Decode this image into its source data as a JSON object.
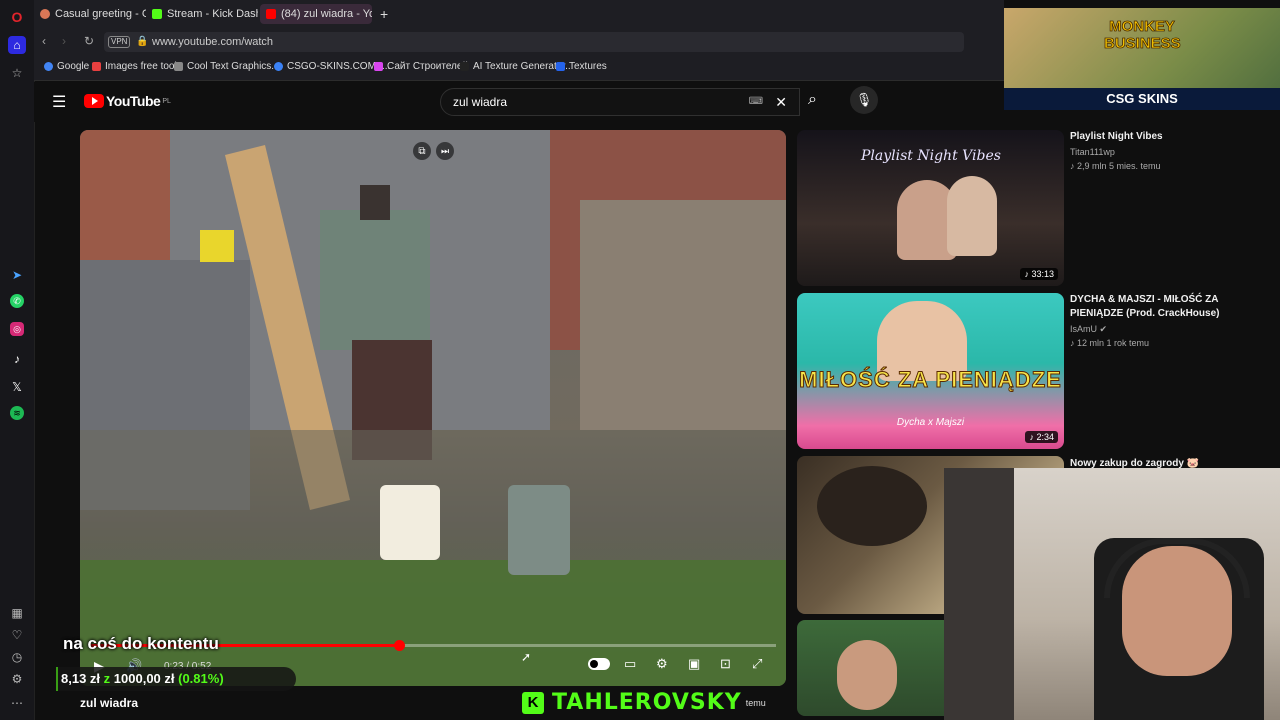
{
  "browser": {
    "tabs": [
      {
        "label": "Casual greeting - Claude"
      },
      {
        "label": "Stream - Kick Dashboard"
      },
      {
        "label": "(84) zul wiadra - YouTube"
      }
    ],
    "new_tab": "+",
    "vpn_badge": "VPN",
    "url": "www.youtube.com/watch",
    "bookmarks": [
      {
        "label": "Google"
      },
      {
        "label": "Images free tools"
      },
      {
        "label": "Cool Text Graphics..."
      },
      {
        "label": "CSGO-SKINS.COM -..."
      },
      {
        "label": "Сайт Строителей"
      },
      {
        "label": "AI Texture Generator..."
      },
      {
        "label": "Textures"
      }
    ]
  },
  "youtube": {
    "logo_text": "YouTube",
    "region": "PL",
    "search_value": "zul wiadra",
    "video_title": "zul wiadra",
    "player": {
      "time": "0:23 / 0:52",
      "progress": 0.45
    },
    "recommendations": [
      {
        "title": "Playlist Night Vibes",
        "thumb_text": "Playlist Night Vibes",
        "channel": "Titan111wp",
        "meta": "2,9 mln  5 mies. temu",
        "duration": "33:13"
      },
      {
        "title": "DYCHA & MAJSZI - MIŁOŚĆ ZA PIENIĄDZE (Prod. CrackHouse)",
        "thumb_text": "MIŁOŚĆ ZA PIENIĄDZE",
        "thumb_sub": "Dycha x Majszi",
        "channel": "IsAmU",
        "meta": "12 mln  1 rok temu",
        "duration": "2:34"
      },
      {
        "title": "Nowy zakup do zagrody 🐷"
      }
    ]
  },
  "stream_overlay": {
    "caption": "na coś do kontentu",
    "goal_current": "8,13 zł",
    "goal_separator": "z",
    "goal_target": "1000,00 zł",
    "goal_percent": "(0.81%)",
    "goal_fraction": 0.0081,
    "kick_channel": "TAHLEROVSKY",
    "kick_suffix": "temu",
    "ad_title_line1": "MONKEY",
    "ad_title_line2": "BUSINESS",
    "ad_brand": "CSG SKINS"
  }
}
